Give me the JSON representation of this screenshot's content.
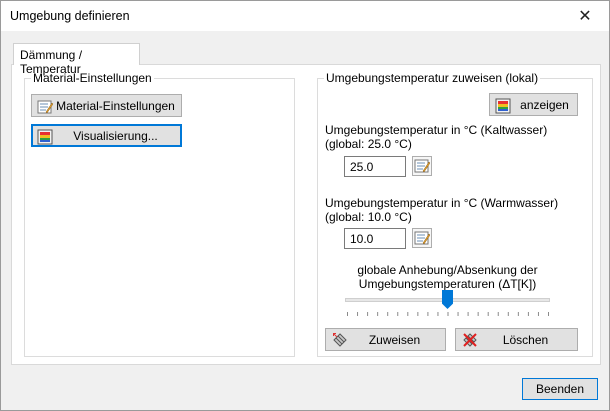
{
  "window": {
    "title": "Umgebung definieren",
    "close_glyph": "✕"
  },
  "tabs": [
    {
      "label": "Dämmung / Temperatur",
      "selected": true
    }
  ],
  "left_group": {
    "label": "Material-Einstellungen",
    "material_button": {
      "label": "Material-Einstellungen",
      "icon": "edit-list-icon"
    },
    "visual_button": {
      "label": "Visualisierung...",
      "icon": "color-palette-icon"
    }
  },
  "right_group": {
    "label": "Umgebungstemperatur zuweisen (lokal)",
    "show_button": {
      "label": "anzeigen",
      "icon": "color-palette-icon"
    },
    "cold": {
      "label_line1": "Umgebungstemperatur in °C (Kaltwasser)",
      "label_line2": "(global: 25.0 °C)",
      "value": "25.0"
    },
    "warm": {
      "label_line1": "Umgebungstemperatur in °C (Warmwasser)",
      "label_line2": "(global: 10.0 °C)",
      "value": "10.0"
    },
    "slider": {
      "label_line1": "globale Anhebung/Absenkung der",
      "label_line2": "Umgebungstemperaturen (ΔT[K])",
      "position": 0.5
    },
    "assign_button": {
      "label": "Zuweisen",
      "icon": "assign-icon"
    },
    "delete_button": {
      "label": "Löschen",
      "icon": "delete-icon"
    }
  },
  "footer": {
    "close_label": "Beenden"
  }
}
